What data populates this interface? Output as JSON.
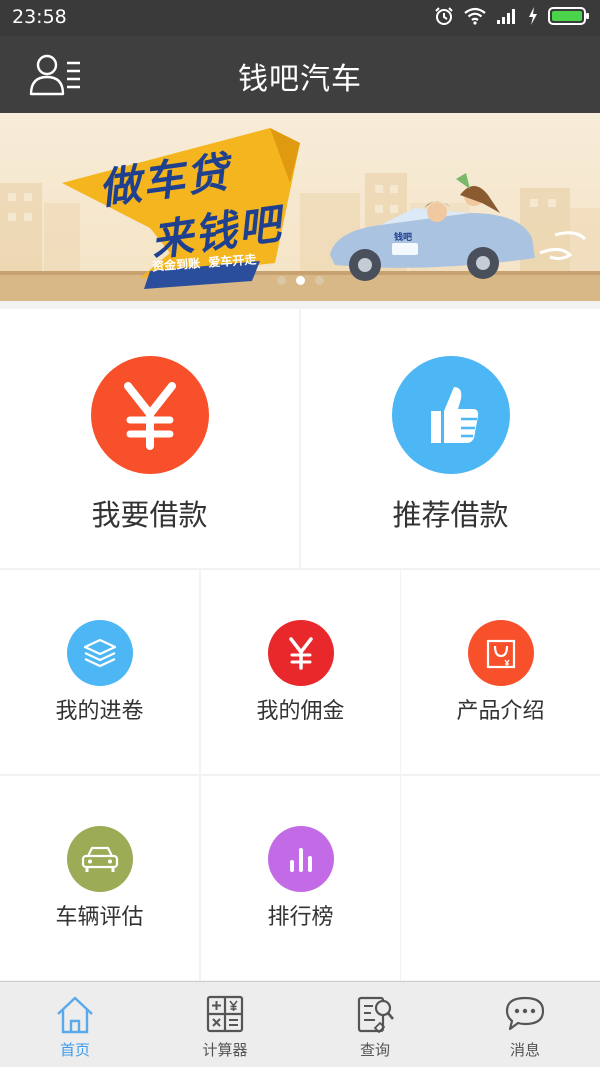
{
  "status_bar": {
    "time": "23:58"
  },
  "header": {
    "title": "钱吧汽车"
  },
  "banner": {
    "headline_line1": "做车贷",
    "headline_line2": "来钱吧",
    "tagline": "资金到账  爱车开走",
    "car_plate": "钱吧",
    "slide_count": 3,
    "active_slide": 2
  },
  "actions": {
    "borrow": {
      "label": "我要借款",
      "symbol": "¥",
      "color": "#f7502a"
    },
    "recommend": {
      "label": "推荐借款",
      "color": "#4db6f5"
    }
  },
  "grid": {
    "progress": {
      "label": "我的进卷",
      "color": "#4db6f5"
    },
    "commission": {
      "label": "我的佣金",
      "symbol": "¥",
      "color": "#e8282b"
    },
    "products": {
      "label": "产品介绍",
      "color": "#f7502a"
    },
    "car_eval": {
      "label": "车辆评估",
      "color": "#9bab56"
    },
    "ranking": {
      "label": "排行榜",
      "color": "#c36be6"
    }
  },
  "bottom_nav": {
    "home": {
      "label": "首页",
      "icon": "home-icon"
    },
    "calculator": {
      "label": "计算器",
      "icon": "calculator-icon"
    },
    "query": {
      "label": "查询",
      "icon": "query-icon"
    },
    "messages": {
      "label": "消息",
      "icon": "chat-bubble-icon"
    }
  },
  "colors": {
    "accent": "#3f9be8",
    "header_bg": "#3f3f3f"
  }
}
